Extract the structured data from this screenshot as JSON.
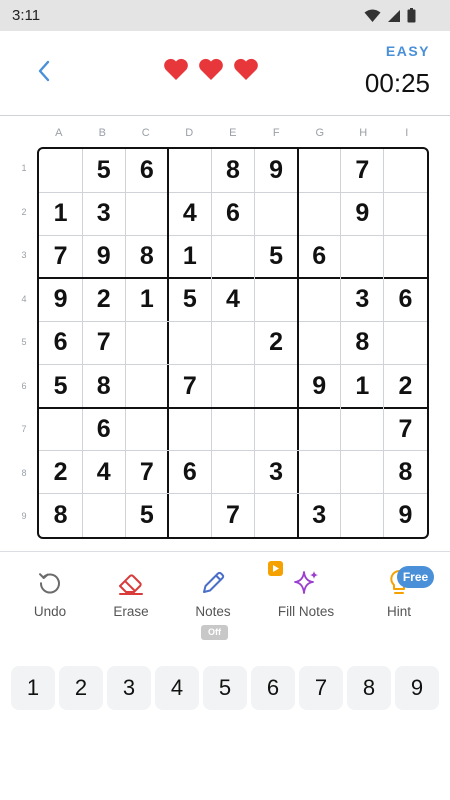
{
  "status_bar": {
    "time": "3:11"
  },
  "header": {
    "difficulty": "EASY",
    "timer": "00:25",
    "lives": 3
  },
  "colors": {
    "accent": "#4a90d9",
    "heart": "#e8373b",
    "erase": "#d93b3b",
    "fill_notes": "#9b3fd0",
    "ad": "#f5a100",
    "hint_bulb": "#f5a100"
  },
  "board": {
    "col_labels": [
      "A",
      "B",
      "C",
      "D",
      "E",
      "F",
      "G",
      "H",
      "I"
    ],
    "row_labels": [
      "1",
      "2",
      "3",
      "4",
      "5",
      "6",
      "7",
      "8",
      "9"
    ],
    "grid": [
      [
        "",
        "5",
        "6",
        "",
        "8",
        "9",
        "",
        "7",
        ""
      ],
      [
        "1",
        "3",
        "",
        "4",
        "6",
        "",
        "",
        "9",
        ""
      ],
      [
        "7",
        "9",
        "8",
        "1",
        "",
        "5",
        "6",
        "",
        ""
      ],
      [
        "9",
        "2",
        "1",
        "5",
        "4",
        "",
        "",
        "3",
        "6"
      ],
      [
        "6",
        "7",
        "",
        "",
        "",
        "2",
        "",
        "8",
        ""
      ],
      [
        "5",
        "8",
        "",
        "7",
        "",
        "",
        "9",
        "1",
        "2"
      ],
      [
        "",
        "6",
        "",
        "",
        "",
        "",
        "",
        "",
        "7"
      ],
      [
        "2",
        "4",
        "7",
        "6",
        "",
        "3",
        "",
        "",
        "8"
      ],
      [
        "8",
        "",
        "5",
        "",
        "7",
        "",
        "3",
        "",
        "9"
      ]
    ]
  },
  "tools": {
    "undo": {
      "label": "Undo",
      "icon": "undo-icon"
    },
    "erase": {
      "label": "Erase",
      "icon": "eraser-icon"
    },
    "notes": {
      "label": "Notes",
      "icon": "pencil-icon",
      "state": "Off"
    },
    "fill_notes": {
      "label": "Fill Notes",
      "icon": "sparkle-icon"
    },
    "hint": {
      "label": "Hint",
      "icon": "lightbulb-icon",
      "badge": "Free"
    }
  },
  "numpad": [
    "1",
    "2",
    "3",
    "4",
    "5",
    "6",
    "7",
    "8",
    "9"
  ]
}
